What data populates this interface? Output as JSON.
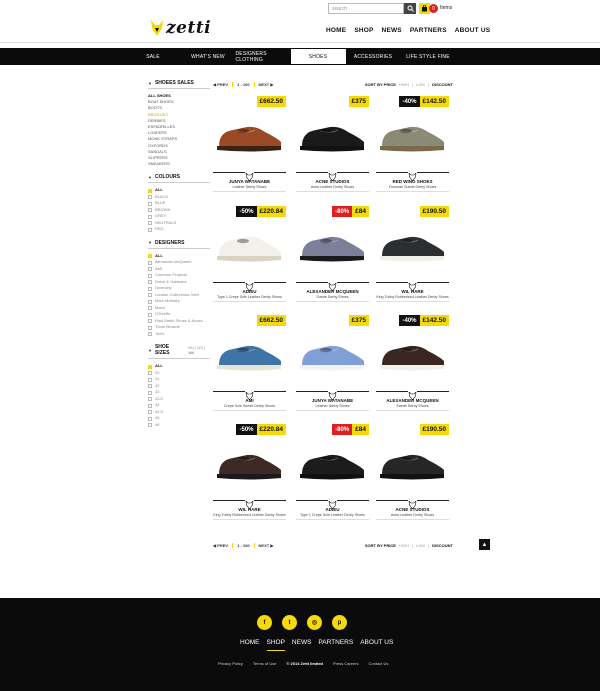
{
  "brand": {
    "logo_text": "zetti",
    "logo_icon": "fox-head-icon"
  },
  "header": {
    "search_placeholder": "search",
    "bag_count": "0",
    "bag_label": "Items",
    "nav": [
      "HOME",
      "SHOP",
      "NEWS",
      "PARTNERS",
      "ABOUT US"
    ]
  },
  "categories": [
    "SALE",
    "WHAT'S NEW",
    "DESIGNERS CLOTHING",
    "SHOES",
    "ACCESSORIES",
    "LIFE STYLE FINE"
  ],
  "active_category": "SHOES",
  "sidebar": {
    "shoes_sales": {
      "title": "SHOEES SALES",
      "items": [
        "ALL SHOES",
        "BOAT SHOES",
        "BOOTS",
        "BROGUES",
        "DERBIES",
        "ESPADRILLES",
        "LOAFERS",
        "MONK STRAPS",
        "OXFORDS",
        "SANDALS",
        "SLIPPERS",
        "SNEAKERS"
      ]
    },
    "colours": {
      "title": "COLOURS",
      "items": [
        "ALL",
        "BLACK",
        "BLUE",
        "BROWN",
        "GREY",
        "NEUTRALS",
        "RED"
      ]
    },
    "designers": {
      "title": "DESIGNERS",
      "items": [
        "ALL",
        "Alexander McQueen",
        "AMI",
        "Common Projects",
        "Dolce & Gabbana",
        "Givenchy",
        "London Collections: Men",
        "Mark McNairy",
        "Marni",
        "O'Keeffe",
        "Paul Smith Shoes & Acces...",
        "Thom Browne",
        "Tod's"
      ]
    },
    "sizes": {
      "title": "SHOE SIZES",
      "switch": [
        "EU",
        "US",
        "UK"
      ],
      "items": [
        "ALL",
        "40",
        "41",
        "42",
        "43",
        "43.5",
        "44",
        "44.5",
        "45",
        "46"
      ]
    }
  },
  "toolbar": {
    "prev": "PREV",
    "range": "1 - 100",
    "next": "NEXT",
    "sort_label": "SORT BY PRICE",
    "sort_options": [
      "HIGH",
      "LOW",
      "DISCOUNT"
    ]
  },
  "products": [
    {
      "price": "£662.50",
      "discount": "",
      "brand": "JUNYA WATANABE",
      "name": "Leather Derby Shoes",
      "upper": "#9a4a24",
      "sole": "#3a2214"
    },
    {
      "price": "£375",
      "discount": "",
      "brand": "ACNE STUDIOS",
      "name": "Astor Leather Derby Shoes",
      "upper": "#1a1a1a",
      "sole": "#111111"
    },
    {
      "price": "£142.50",
      "discount": "-40%",
      "discount_bg": "#111111",
      "brand": "RED WING SHOES",
      "name": "Foreman Suede Derby Shoes",
      "upper": "#8a8a76",
      "sole": "#7a6a4a"
    },
    {
      "price": "£220.84",
      "discount": "-50%",
      "discount_bg": "#111111",
      "brand": "ADIEU",
      "name": "Type 1 Crepe Sole Leather Derby Shoes",
      "upper": "#f1f0ea",
      "sole": "#d8d3c2"
    },
    {
      "price": "£84",
      "discount": "-80%",
      "discount_bg": "#e02020",
      "brand": "ALEXANDER MCQUEEN",
      "name": "Suede Derby Shoes",
      "upper": "#7b7f9a",
      "sole": "#1a1a1a"
    },
    {
      "price": "£190.50",
      "discount": "",
      "brand": "WIL HARE",
      "name": "King Tubby Rubberised Leather Derby Shoes",
      "upper": "#2c2f32",
      "sole": "#f1f0ea"
    },
    {
      "price": "£662.50",
      "discount": "",
      "brand": "AMI",
      "name": "Crepe Sole Suede Derby Shoes",
      "upper": "#3f74a6",
      "sole": "#e8e4d6"
    },
    {
      "price": "£375",
      "discount": "",
      "brand": "JUNYA WATANABE",
      "name": "Leather Derby Shoes",
      "upper": "#7f9fd6",
      "sole": "#f3f3f3"
    },
    {
      "price": "£142.50",
      "discount": "-40%",
      "discount_bg": "#111111",
      "brand": "ALEXANDER MCQUEEN",
      "name": "Suede Derby Shoes",
      "upper": "#3a2723",
      "sole": "#f1f0ea"
    },
    {
      "price": "£220.84",
      "discount": "-50%",
      "discount_bg": "#111111",
      "brand": "WIL HARE",
      "name": "King Tubby Rubberised Leather Derby Shoes",
      "upper": "#3d2a25",
      "sole": "#1a1a1a"
    },
    {
      "price": "£84",
      "discount": "-80%",
      "discount_bg": "#e02020",
      "brand": "ADIEU",
      "name": "Type 1 Crepe Sole Leather Derby Shoes",
      "upper": "#1c1c1c",
      "sole": "#111111"
    },
    {
      "price": "£190.50",
      "discount": "",
      "brand": "ACNE STUDIOS",
      "name": "Astor Leather Derby Shoes",
      "upper": "#262626",
      "sole": "#111111"
    }
  ],
  "footer": {
    "social": [
      "f",
      "t",
      "◎",
      "p"
    ],
    "nav": [
      "HOME",
      "SHOP",
      "NEWS",
      "PARTNERS",
      "ABOUT US"
    ],
    "links": [
      "Privacy Policy",
      "Terms of Use",
      "© 2014 Zetti limited",
      "Press Careers",
      "Contact Us"
    ]
  },
  "colors": {
    "accent": "#f5d90a",
    "sale_red": "#e02020",
    "dark": "#0b0b0b"
  }
}
